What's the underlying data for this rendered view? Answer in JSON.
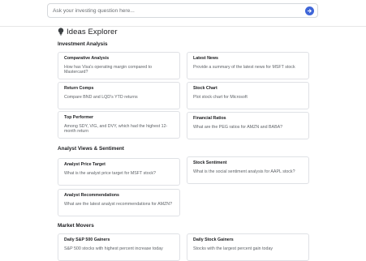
{
  "search": {
    "placeholder": "Ask your investing question here..."
  },
  "page": {
    "title": "Ideas Explorer",
    "icon": "lightbulb-icon"
  },
  "sections": [
    {
      "title": "Investment Analysis",
      "cards": [
        {
          "title": "Comparative Analysis",
          "desc": "How has Visa's operating margin compared to Mastercard?"
        },
        {
          "title": "Latest News",
          "desc": "Provide a summary of the latest news for MSFT stock"
        },
        {
          "title": "Return Comps",
          "desc": "Compare BND and LQD's YTD returns"
        },
        {
          "title": "Stock Chart",
          "desc": "Plot stock chart for Microsoft"
        },
        {
          "title": "Top Performer",
          "desc": "Among SDY, VIG, and DVY, which had the highest 12-month return"
        },
        {
          "title": "Financial Ratios",
          "desc": "What are the PEG ratios for AMZN and BABA?"
        }
      ]
    },
    {
      "title": "Analyst Views & Sentiment",
      "cards": [
        {
          "title": "Analyst Price Target",
          "desc": "What is the analyst price target for MSFT stock?"
        },
        {
          "title": "Stock Sentiment",
          "desc": "What is the social sentiment analysis for AAPL stock?"
        },
        {
          "title": "Analyst Recommendations",
          "desc": "What are the latest analyst recommendations for AMZN?"
        }
      ]
    },
    {
      "title": "Market Movers",
      "cards": [
        {
          "title": "Daily S&P 500 Gainers",
          "desc": "S&P 500 stocks with highest percent increase today"
        },
        {
          "title": "Daily Stock Gainers",
          "desc": "Stocks with the largest percent gain today"
        }
      ]
    }
  ],
  "colors": {
    "accent": "#3f66d8",
    "border": "#dfe1e5",
    "text": "#202124",
    "muted": "#5f6368"
  }
}
